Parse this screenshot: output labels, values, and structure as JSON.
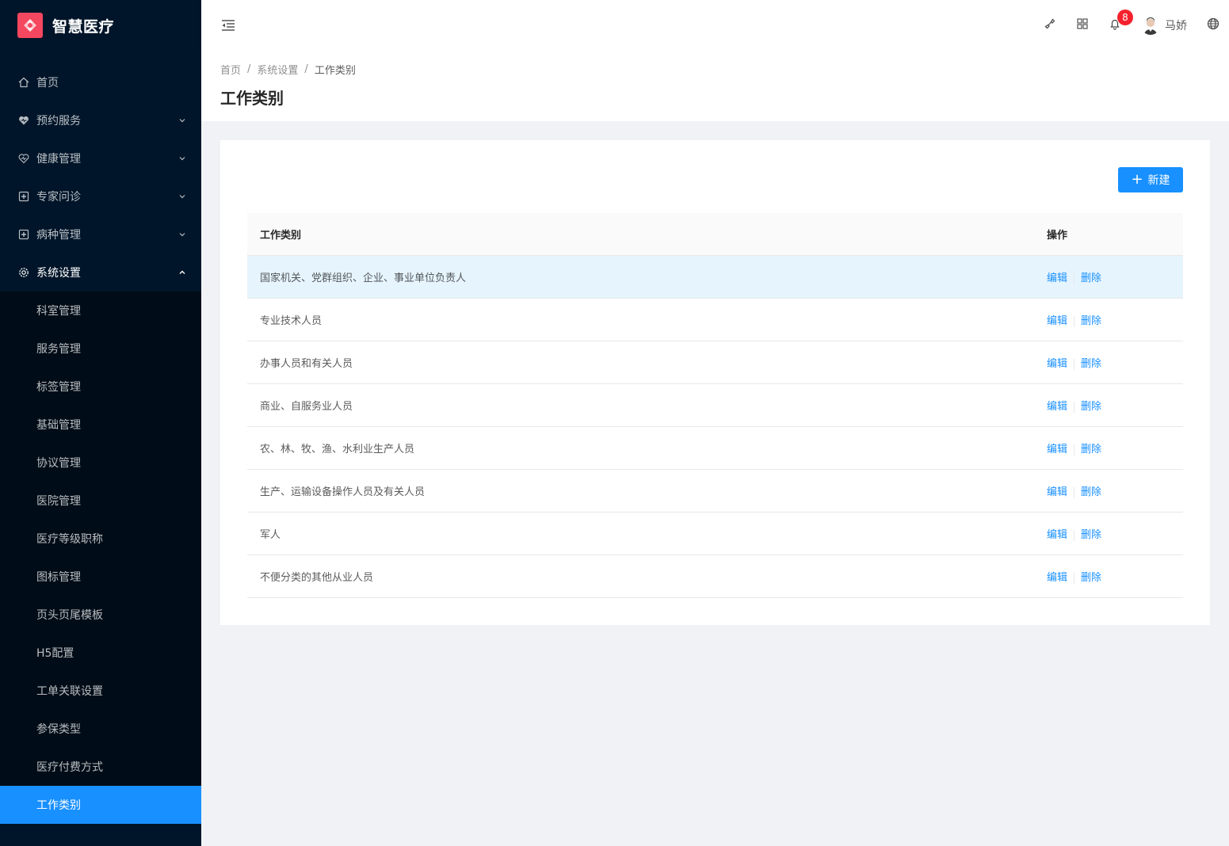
{
  "app": {
    "title": "智慧医疗"
  },
  "sidebar": {
    "items": [
      {
        "label": "首页",
        "icon": "home-icon",
        "has_children": false
      },
      {
        "label": "预约服务",
        "icon": "heart-icon",
        "has_children": true
      },
      {
        "label": "健康管理",
        "icon": "heart-pulse-icon",
        "has_children": true
      },
      {
        "label": "专家问诊",
        "icon": "medical-box-icon",
        "has_children": true
      },
      {
        "label": "病种管理",
        "icon": "medical-box-icon",
        "has_children": true
      },
      {
        "label": "系统设置",
        "icon": "settings-icon",
        "has_children": true,
        "expanded": true
      }
    ],
    "submenu": [
      {
        "label": "科室管理"
      },
      {
        "label": "服务管理"
      },
      {
        "label": "标签管理"
      },
      {
        "label": "基础管理"
      },
      {
        "label": "协议管理"
      },
      {
        "label": "医院管理"
      },
      {
        "label": "医疗等级职称"
      },
      {
        "label": "图标管理"
      },
      {
        "label": "页头页尾模板"
      },
      {
        "label": "H5配置"
      },
      {
        "label": "工单关联设置"
      },
      {
        "label": "参保类型"
      },
      {
        "label": "医疗付费方式"
      },
      {
        "label": "工作类别",
        "selected": true
      }
    ]
  },
  "header": {
    "notification_count": "8",
    "username": "马娇"
  },
  "breadcrumb": [
    "首页",
    "系统设置",
    "工作类别"
  ],
  "page_title": "工作类别",
  "toolbar": {
    "new_label": "新建"
  },
  "table": {
    "columns": [
      "工作类别",
      "操作"
    ],
    "rows": [
      {
        "name": "国家机关、党群组织、企业、事业单位负责人"
      },
      {
        "name": "专业技术人员"
      },
      {
        "name": "办事人员和有关人员"
      },
      {
        "name": "商业、自服务业人员"
      },
      {
        "name": "农、林、牧、渔、水利业生产人员"
      },
      {
        "name": "生产、运输设备操作人员及有关人员"
      },
      {
        "name": "军人"
      },
      {
        "name": "不便分类的其他从业人员"
      }
    ],
    "edit_label": "编辑",
    "delete_label": "删除"
  },
  "colors": {
    "sidebar_bg": "#001529",
    "submenu_bg": "#000c17",
    "primary": "#1890ff",
    "logo": "#f5475f",
    "badge": "#f5222d"
  }
}
